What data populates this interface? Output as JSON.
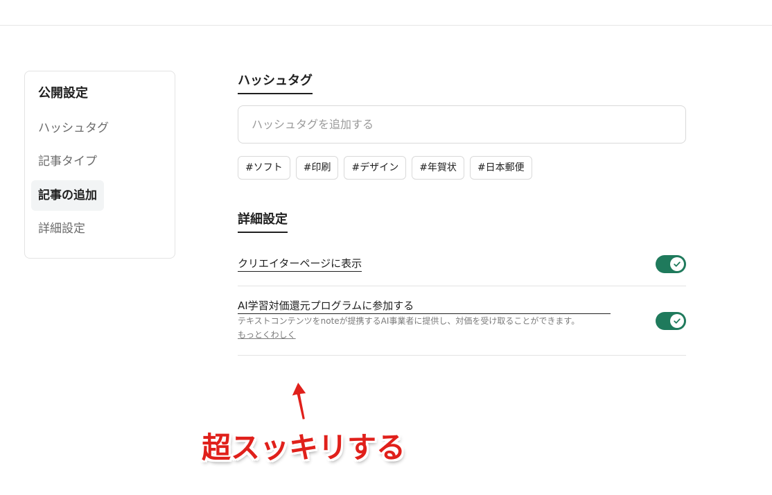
{
  "sidebar": {
    "title": "公開設定",
    "items": [
      {
        "label": "ハッシュタグ"
      },
      {
        "label": "記事タイプ"
      },
      {
        "label": "記事の追加"
      },
      {
        "label": "詳細設定"
      }
    ]
  },
  "hashtag": {
    "title": "ハッシュタグ",
    "input_placeholder": "ハッシュタグを追加する",
    "chips": [
      "#ソフト",
      "#印刷",
      "#デザイン",
      "#年賀状",
      "#日本郵便"
    ]
  },
  "details": {
    "title": "詳細設定",
    "settings": [
      {
        "label": "クリエイターページに表示",
        "enabled": true
      },
      {
        "label": "AI学習対価還元プログラムに参加する",
        "description": "テキストコンテンツをnoteが提携するAI事業者に提供し、対価を受け取ることができます。",
        "link": "もっとくわしく",
        "enabled": true
      }
    ]
  },
  "annotation": {
    "text": "超スッキリする",
    "color": "#e0201b"
  },
  "colors": {
    "toggle_on": "#1f7a5c"
  }
}
